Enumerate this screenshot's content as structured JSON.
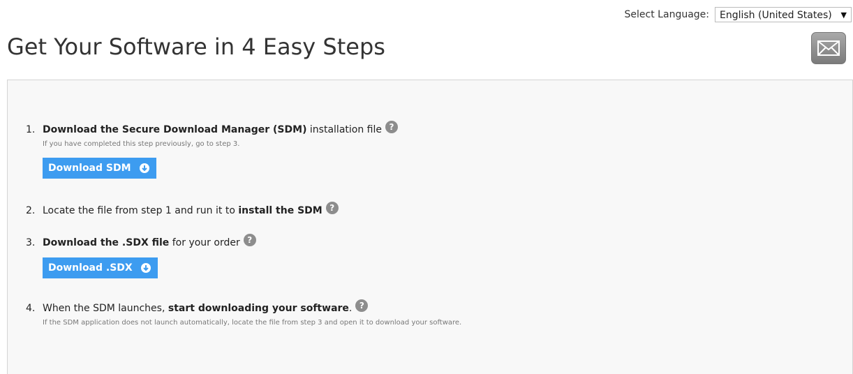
{
  "language": {
    "label": "Select Language:",
    "selected": "English (United States)"
  },
  "title": "Get Your Software in 4 Easy Steps",
  "steps": [
    {
      "number": "1.",
      "bold": "Download the Secure Download Manager (SDM)",
      "rest": " installation file",
      "note": "If you have completed this step previously, go to step 3.",
      "button": "Download SDM"
    },
    {
      "number": "2.",
      "pre": "Locate the file from step 1 and run it to ",
      "bold": "install the SDM"
    },
    {
      "number": "3.",
      "bold": "Download the .SDX file",
      "rest": " for your order",
      "button": "Download .SDX"
    },
    {
      "number": "4.",
      "pre": "When the SDM launches, ",
      "bold": "start downloading your software",
      "rest": ".",
      "note": "If the SDM application does not launch automatically, locate the file from step 3 and open it to download your software."
    }
  ],
  "icons": {
    "help": "question-circle-icon",
    "download": "download-arrow-icon",
    "email": "envelope-icon",
    "dropdown": "caret-down-icon"
  },
  "colors": {
    "button": "#3d9cf0",
    "help_icon": "#8d8d8d",
    "panel_bg": "#f8f8f8"
  }
}
